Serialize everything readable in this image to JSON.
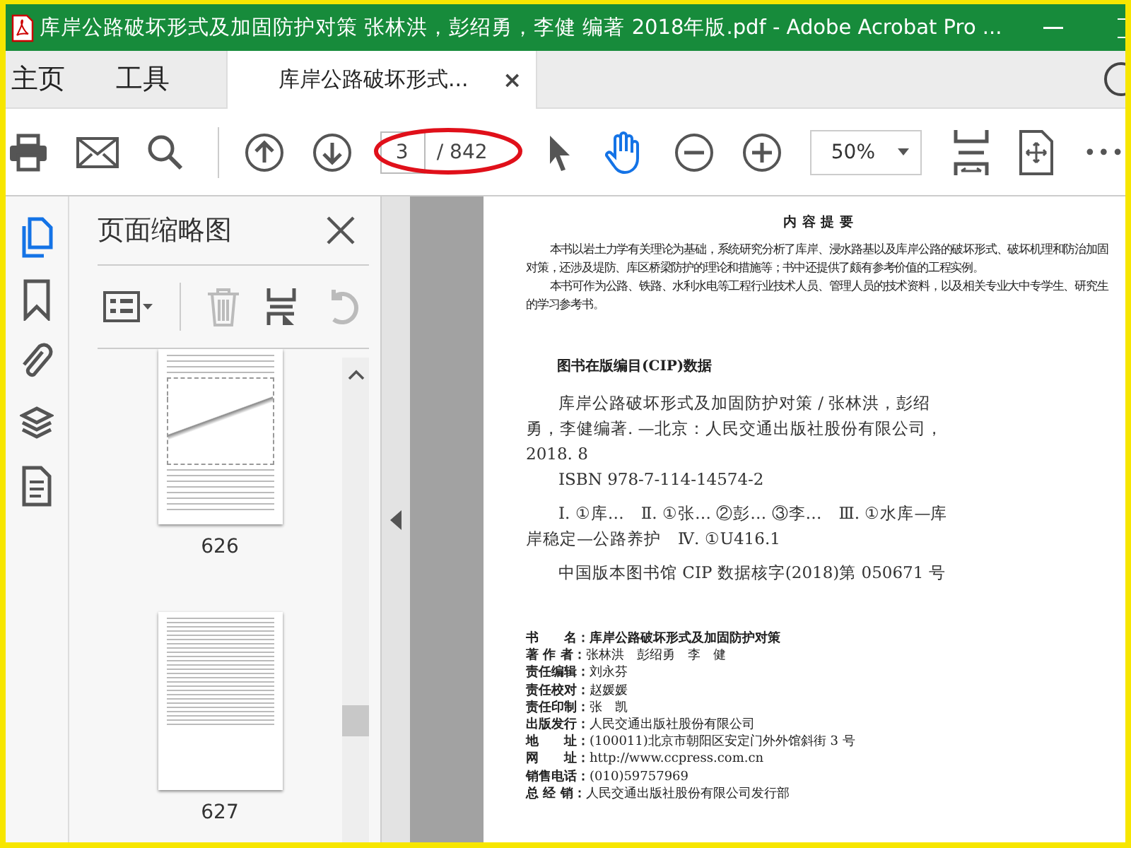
{
  "window": {
    "title": "库岸公路破坏形式及加固防护对策 张林洪，彭绍勇，李健 编著 2018年版.pdf - Adobe Acrobat Pro ..."
  },
  "menu_tabs": [
    {
      "label": "主页"
    },
    {
      "label": "工具"
    }
  ],
  "document_tab": {
    "label": "库岸公路破坏形式...",
    "close": "×"
  },
  "toolbar": {
    "page_field": {
      "value": "3",
      "total": "/ 842"
    },
    "tools": [
      {
        "kind": "select",
        "selected": false
      },
      {
        "kind": "hand",
        "selected": true
      }
    ],
    "zoom": {
      "value": "50%"
    },
    "more": "•••"
  },
  "rail": [
    {
      "kind": "pages",
      "selected": true
    },
    {
      "kind": "bookmarks",
      "selected": false
    },
    {
      "kind": "attachments",
      "selected": false
    },
    {
      "kind": "layers",
      "selected": false
    },
    {
      "kind": "content",
      "selected": false
    }
  ],
  "panel": {
    "title": "页面缩略图",
    "thumbnails": [
      {
        "kind": "figure",
        "label": "626"
      },
      {
        "kind": "text",
        "label": "627"
      }
    ]
  },
  "page": {
    "abstract_title": "内 容 提 要",
    "abstract": [
      "本书以岩土力学有关理论为基础，系统研究分析了库岸、浸水路基以及库岸公路的破坏形式、破坏机理和防治加固对策，还涉及堤防、库区桥梁防护的理论和措施等；书中还提供了颇有参考价值的工程实例。",
      "本书可作为公路、铁路、水利水电等工程行业技术人员、管理人员的技术资料，以及相关专业大中专学生、研究生的学习参考书。"
    ],
    "cip_title": "图书在版编目(CIP)数据",
    "cip_entry": "库岸公路破坏形式及加固防护对策 / 张林洪，彭绍勇，李健编著. —北京：人民交通出版社股份有限公司，2018. 8",
    "isbn": "ISBN 978-7-114-14574-2",
    "classification": "Ⅰ. ①库…　Ⅱ. ①张…  ②彭…  ③李…　Ⅲ. ①水库—库岸稳定—公路养护　Ⅳ. ①U416.1",
    "cip_number": "中国版本图书馆 CIP 数据核字(2018)第 050671 号",
    "details": [
      {
        "label": "书　　名：",
        "value": "库岸公路破坏形式及加固防护对策",
        "kind": "bold"
      },
      {
        "label": "著 作 者：",
        "value": "张林洪　彭绍勇　李　健",
        "kind": "plain"
      },
      {
        "label": "责任编辑：",
        "value": "刘永芬",
        "kind": "plain"
      },
      {
        "label": "责任校对：",
        "value": "赵媛媛",
        "kind": "plain"
      },
      {
        "label": "责任印制：",
        "value": "张　凯",
        "kind": "plain"
      },
      {
        "label": "出版发行：",
        "value": "人民交通出版社股份有限公司",
        "kind": "plain"
      },
      {
        "label": "地　　址：",
        "value": "(100011)北京市朝阳区安定门外外馆斜街 3 号",
        "kind": "plain"
      },
      {
        "label": "网　　址：",
        "value": "http://www.ccpress.com.cn",
        "kind": "plain"
      },
      {
        "label": "销售电话：",
        "value": "(010)59757969",
        "kind": "plain"
      },
      {
        "label": "总 经 销：",
        "value": "人民交通出版社股份有限公司发行部",
        "kind": "plain"
      }
    ]
  }
}
